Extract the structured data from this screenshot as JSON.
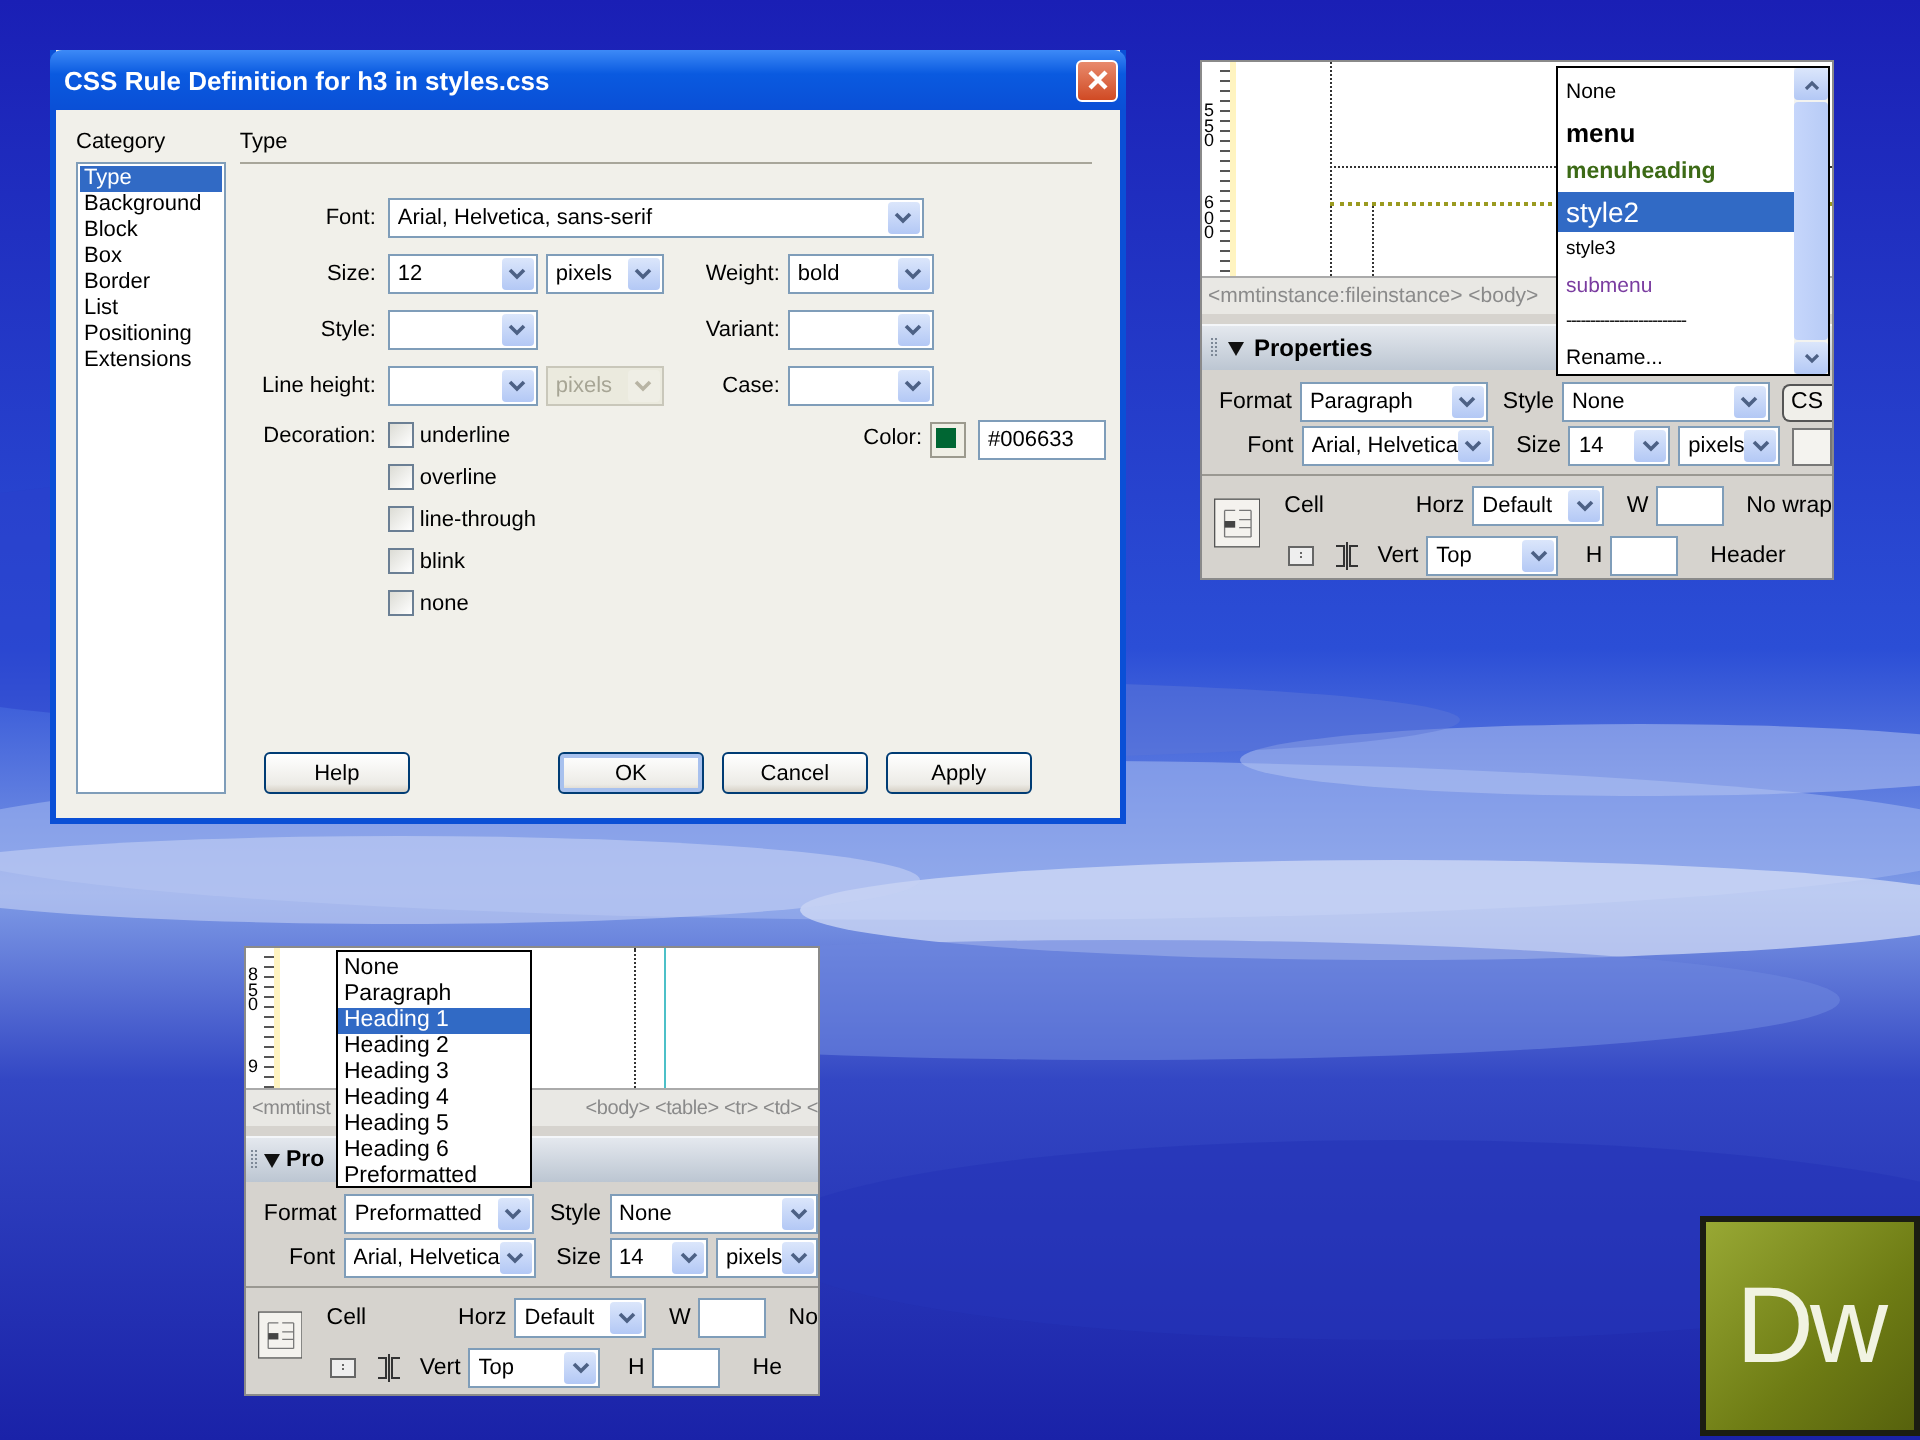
{
  "dialog": {
    "title": "CSS Rule Definition for h3 in styles.css",
    "category_heading": "Category",
    "categories": [
      {
        "label": "Type",
        "selected": true
      },
      {
        "label": "Background",
        "selected": false
      },
      {
        "label": "Block",
        "selected": false
      },
      {
        "label": "Box",
        "selected": false
      },
      {
        "label": "Border",
        "selected": false
      },
      {
        "label": "List",
        "selected": false
      },
      {
        "label": "Positioning",
        "selected": false
      },
      {
        "label": "Extensions",
        "selected": false
      }
    ],
    "section_title": "Type",
    "font": {
      "label": "Font:",
      "value": "Arial, Helvetica, sans-serif"
    },
    "size": {
      "label": "Size:",
      "value": "12",
      "unit": "pixels"
    },
    "weight": {
      "label": "Weight:",
      "value": "bold"
    },
    "style": {
      "label": "Style:"
    },
    "variant": {
      "label": "Variant:"
    },
    "line_height": {
      "label": "Line height:",
      "unit": "pixels",
      "unit_disabled": true
    },
    "case": {
      "label": "Case:"
    },
    "decoration": {
      "label": "Decoration:",
      "options": [
        {
          "label": "underline",
          "checked": false
        },
        {
          "label": "overline",
          "checked": false
        },
        {
          "label": "line-through",
          "checked": false
        },
        {
          "label": "blink",
          "checked": false
        },
        {
          "label": "none",
          "checked": false
        }
      ]
    },
    "color": {
      "label": "Color:",
      "value": "#006633",
      "color": "#006633"
    },
    "buttons": [
      {
        "label": "Help",
        "default": false
      },
      {
        "label": "OK",
        "default": true
      },
      {
        "label": "Cancel",
        "default": false
      },
      {
        "label": "Apply",
        "default": false
      }
    ]
  },
  "panels": [
    {
      "ruler_marks": [
        "550",
        "600"
      ],
      "tag_path": [
        "<mmtinstance:fileinstance> <body>"
      ],
      "title": "Properties",
      "format": {
        "label": "Format",
        "value": "Paragraph"
      },
      "style": {
        "label": "Style",
        "value": "None"
      },
      "css_button": "CS",
      "font": {
        "label": "Font",
        "value": "Arial, Helvetica"
      },
      "size": {
        "label": "Size",
        "value": "14",
        "unit": "pixels"
      },
      "color_button": true,
      "cell": {
        "label": "Cell",
        "horz": {
          "label": "Horz",
          "value": "Default"
        },
        "w_label": "W",
        "no_wrap": "No wrap",
        "vert": {
          "label": "Vert",
          "value": "Top"
        },
        "h_label": "H",
        "header": "Header"
      },
      "dropdown": [
        {
          "label": "None",
          "kind": "plain",
          "selected": false
        },
        {
          "label": "menu",
          "kind": "bold",
          "selected": false
        },
        {
          "label": "menuheading",
          "kind": "heading",
          "selected": false
        },
        {
          "label": "style2",
          "kind": "large",
          "selected": true
        },
        {
          "label": "style3",
          "kind": "small",
          "selected": false
        },
        {
          "label": "submenu",
          "kind": "link",
          "selected": false
        },
        {
          "label": "-------------------------",
          "kind": "separator",
          "selected": false
        },
        {
          "label": "Rename...",
          "kind": "plain",
          "selected": false
        }
      ]
    },
    {
      "ruler_marks": [
        "850",
        "9"
      ],
      "tag_path": [
        "<mmtinst",
        "<body> <table> <tr> <td> <"
      ],
      "title": "Pro",
      "format": {
        "label": "Format",
        "value": "Preformatted"
      },
      "style": {
        "label": "Style",
        "value": "None"
      },
      "font": {
        "label": "Font",
        "value": "Arial, Helvetica"
      },
      "size": {
        "label": "Size",
        "value": "14",
        "unit": "pixels"
      },
      "color_button": false,
      "cell": {
        "label": "Cell",
        "horz": {
          "label": "Horz",
          "value": "Default"
        },
        "w_label": "W",
        "no_wrap": "No",
        "vert": {
          "label": "Vert",
          "value": "Top"
        },
        "h_label": "H",
        "header": "He"
      },
      "dropdown": [
        {
          "label": "None",
          "kind": "plain",
          "selected": false
        },
        {
          "label": "Paragraph",
          "kind": "plain",
          "selected": false
        },
        {
          "label": "Heading 1",
          "kind": "plain",
          "selected": true
        },
        {
          "label": "Heading 2",
          "kind": "plain",
          "selected": false
        },
        {
          "label": "Heading 3",
          "kind": "plain",
          "selected": false
        },
        {
          "label": "Heading 4",
          "kind": "plain",
          "selected": false
        },
        {
          "label": "Heading 5",
          "kind": "plain",
          "selected": false
        },
        {
          "label": "Heading 6",
          "kind": "plain",
          "selected": false
        },
        {
          "label": "Preformatted",
          "kind": "plain",
          "selected": false
        }
      ]
    }
  ],
  "logo": {
    "text": "Dw"
  }
}
